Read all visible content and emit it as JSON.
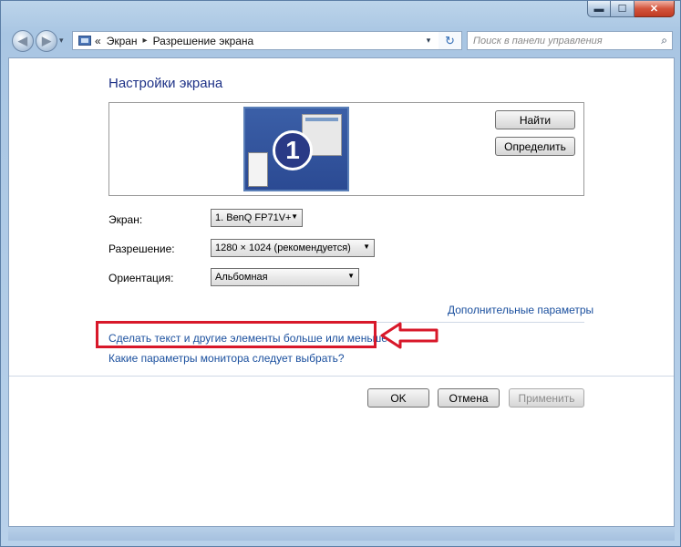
{
  "window": {
    "caption_buttons": {
      "minimize": "▬",
      "maximize": "☐",
      "close": "✕"
    }
  },
  "nav": {
    "back_glyph": "◀",
    "forward_glyph": "▶",
    "dropdown_glyph": "▾",
    "breadcrumb_prefix": "«",
    "breadcrumb": [
      "Экран",
      "Разрешение экрана"
    ],
    "breadcrumb_separator": "▸",
    "refresh_glyph": "↻",
    "search_placeholder": "Поиск в панели управления",
    "search_icon_glyph": "⌕"
  },
  "page": {
    "title": "Настройки экрана",
    "monitor_number": "1",
    "buttons": {
      "find": "Найти",
      "identify": "Определить"
    },
    "fields": [
      {
        "label": "Экран:",
        "value": "1. BenQ FP71V+"
      },
      {
        "label": "Разрешение:",
        "value": "1280 × 1024 (рекомендуется)"
      },
      {
        "label": "Ориентация:",
        "value": "Альбомная"
      }
    ],
    "links": {
      "advanced": "Дополнительные параметры",
      "text_size": "Сделать текст и другие элементы больше или меньше",
      "which_settings": "Какие параметры монитора следует выбрать?"
    },
    "footer_buttons": {
      "ok": "OK",
      "cancel": "Отмена",
      "apply": "Применить"
    }
  },
  "colors": {
    "link": "#1a4f9e",
    "title": "#1e3287",
    "highlight_red": "#d8182a"
  }
}
